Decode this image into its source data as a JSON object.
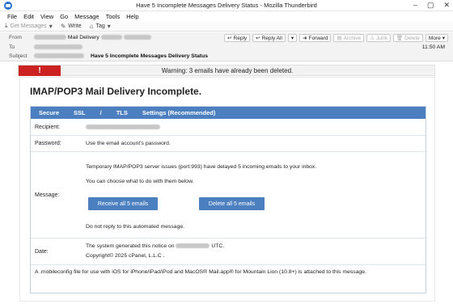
{
  "window": {
    "title": "Have 5 Incomplete Messages Delivery Status - Mozilla Thunderbird",
    "controls": [
      "–",
      "▢",
      "✕"
    ]
  },
  "menu": [
    "File",
    "Edit",
    "View",
    "Go",
    "Message",
    "Tools",
    "Help"
  ],
  "toolbar": {
    "get_messages": "Get Messages",
    "write": "Write",
    "tag": "Tag"
  },
  "headers": {
    "from_label": "From",
    "from_value": "Mail Delivery",
    "to_label": "To",
    "subject_label": "Subject",
    "subject_value": "Have 5 Incomplete Messages Delivery Status",
    "time": "11:50 AM",
    "buttons": {
      "reply": "Reply",
      "reply_all": "Reply All",
      "forward": "Forward",
      "archive": "Archive",
      "junk": "Junk",
      "delete": "Delete",
      "more": "More"
    }
  },
  "warning": {
    "badge": "!",
    "text": "Warning: 3 emails have already been deleted."
  },
  "card": {
    "title": "IMAP/POP3 Mail Delivery Incomplete.",
    "tabs": [
      "Secure",
      "SSL",
      "/",
      "TLS",
      "Settings (Recommended)"
    ],
    "recipient_label": "Recipient:",
    "password_label": "Password:",
    "password_value": "Use the email account's password.",
    "message_label": "Message:",
    "message_line1": "Temporary IMAP/POP3 server issues (port:993) have delayed 5 incoming emails to your inbox.",
    "message_line2": "You can choose what to do with them below.",
    "receive_button": "Receive all 5 emails",
    "delete_button": "Delete all 5 emails",
    "no_reply": "Do not reply to this automated message.",
    "date_label": "Date:",
    "date_line1_a": "The system generated this notice on",
    "date_line1_b": "UTC.",
    "copyright": "Copyright© 2025 cPanel, L.L.C .",
    "attachment_note": "A .mobileconfig file for use with iOS for iPhone/iPad/iPod and MacOS® Mail.app® for Mountain Lion (10.8+) is attached to this message."
  },
  "colors": {
    "accent_blue": "#4b7fc0",
    "warning_red": "#cc2222"
  }
}
